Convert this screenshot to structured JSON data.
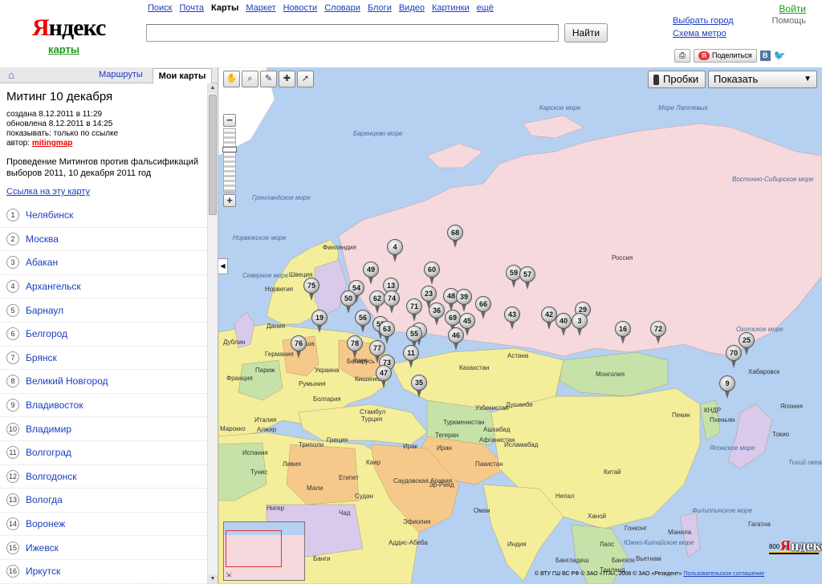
{
  "logo": {
    "first_letter": "Я",
    "rest": "ндекс",
    "service": "карты"
  },
  "topnav": [
    {
      "label": "Поиск",
      "current": false
    },
    {
      "label": "Почта",
      "current": false
    },
    {
      "label": "Карты",
      "current": true
    },
    {
      "label": "Маркет",
      "current": false
    },
    {
      "label": "Новости",
      "current": false
    },
    {
      "label": "Словари",
      "current": false
    },
    {
      "label": "Блоги",
      "current": false
    },
    {
      "label": "Видео",
      "current": false
    },
    {
      "label": "Картинки",
      "current": false
    },
    {
      "label": "ещё",
      "current": false
    }
  ],
  "search": {
    "value": "",
    "button_label": "Найти"
  },
  "user": {
    "login": "Войти",
    "help": "Помощь"
  },
  "links": {
    "choose_city": "Выбрать город",
    "metro": "Схема метро"
  },
  "share": {
    "print_icon": "printer-icon",
    "share_label": "Поделиться",
    "vk": "B",
    "twitter_icon": "twitter-icon"
  },
  "sidebar": {
    "tab_routes": "Маршруты",
    "tab_mymaps": "Мои карты",
    "title": "Митинг 10 декабря",
    "created": "создана 8.12.2011 в 11:29",
    "updated": "обновлена 8.12.2011 в 14:25",
    "visibility": "показывать: только по ссылке",
    "author_prefix": "автор: ",
    "author": "mitingmap",
    "description": "Проведение Митингов против фальсификаций выборов 2011, 10 декабря 2011 год",
    "link_label": "Ссылка на эту карту",
    "points": [
      {
        "n": "1",
        "label": "Челябинск"
      },
      {
        "n": "2",
        "label": "Москва"
      },
      {
        "n": "3",
        "label": "Абакан"
      },
      {
        "n": "4",
        "label": "Архангельск"
      },
      {
        "n": "5",
        "label": "Барнаул"
      },
      {
        "n": "6",
        "label": "Белгород"
      },
      {
        "n": "7",
        "label": "Брянск"
      },
      {
        "n": "8",
        "label": "Великий Новгород"
      },
      {
        "n": "9",
        "label": "Владивосток"
      },
      {
        "n": "10",
        "label": "Владимир"
      },
      {
        "n": "11",
        "label": "Волгоград"
      },
      {
        "n": "12",
        "label": "Волгодонск"
      },
      {
        "n": "13",
        "label": "Вологда"
      },
      {
        "n": "14",
        "label": "Воронеж"
      },
      {
        "n": "15",
        "label": "Ижевск"
      },
      {
        "n": "16",
        "label": "Иркутск"
      }
    ]
  },
  "map": {
    "traffic_label": "Пробки",
    "show_label": "Показать",
    "scale_label": "800 км",
    "copyright": "© ВТУ ГШ ВС РФ © ЗАО «ТГА», 2008 © ЗАО «Резидент»",
    "terms": "Пользовательское соглашение",
    "colors": {
      "sea": "#b5d0f0",
      "russia": "#f5d9dc",
      "europe_yellow": "#f4ee9a",
      "green": "#c6e2a8",
      "orange": "#f6c98a",
      "purple": "#d9c9ea"
    },
    "labels": [
      {
        "t": "Карское море",
        "sea": true
      },
      {
        "t": "Море Лаптевых",
        "sea": true
      },
      {
        "t": "Баренцево море",
        "sea": true
      },
      {
        "t": "Гренландское море",
        "sea": true
      },
      {
        "t": "Норвежское море",
        "sea": true
      },
      {
        "t": "Восточно-Сибирское море",
        "sea": true
      },
      {
        "t": "Охотское море",
        "sea": true
      },
      {
        "t": "Северное море",
        "sea": true
      },
      {
        "t": "Россия",
        "sea": false
      },
      {
        "t": "Финляндия",
        "sea": false
      },
      {
        "t": "Швеция",
        "sea": false
      },
      {
        "t": "Норвегия",
        "sea": false
      },
      {
        "t": "Дания",
        "sea": false
      },
      {
        "t": "Дублин",
        "sea": false
      },
      {
        "t": "Германия",
        "sea": false
      },
      {
        "t": "Париж",
        "sea": false
      },
      {
        "t": "Франция",
        "sea": false
      },
      {
        "t": "Украина",
        "sea": false
      },
      {
        "t": "Киев",
        "sea": false
      },
      {
        "t": "Кишинев",
        "sea": false
      },
      {
        "t": "Румыния",
        "sea": false
      },
      {
        "t": "Болгария",
        "sea": false
      },
      {
        "t": "Стамбул",
        "sea": false
      },
      {
        "t": "Турция",
        "sea": false
      },
      {
        "t": "Казахстан",
        "sea": false
      },
      {
        "t": "Астана",
        "sea": false
      },
      {
        "t": "Монголия",
        "sea": false
      },
      {
        "t": "Хабаровск",
        "sea": false
      },
      {
        "t": "Пекин",
        "sea": false
      },
      {
        "t": "КНДР",
        "sea": false
      },
      {
        "t": "Пхеньян",
        "sea": false
      },
      {
        "t": "Японское море",
        "sea": true
      },
      {
        "t": "Токио",
        "sea": false
      },
      {
        "t": "Тегеран",
        "sea": false
      },
      {
        "t": "Ашхабад",
        "sea": false
      },
      {
        "t": "Туркменистан",
        "sea": false
      },
      {
        "t": "Узбекистан",
        "sea": false
      },
      {
        "t": "Душанбе",
        "sea": false
      },
      {
        "t": "Афганистан",
        "sea": false
      },
      {
        "t": "Исламабад",
        "sea": false
      },
      {
        "t": "Алжир",
        "sea": false
      },
      {
        "t": "Триполи",
        "sea": false
      },
      {
        "t": "Каир",
        "sea": false
      },
      {
        "t": "Египет",
        "sea": false
      },
      {
        "t": "Саудовская Аравия",
        "sea": false
      },
      {
        "t": "Эр-Рияд",
        "sea": false
      },
      {
        "t": "Нигер",
        "sea": false
      },
      {
        "t": "Чад",
        "sea": false
      },
      {
        "t": "Судан",
        "sea": false
      },
      {
        "t": "Эфиопия",
        "sea": false
      },
      {
        "t": "Аддис-Абеба",
        "sea": false
      },
      {
        "t": "Индия",
        "sea": false
      },
      {
        "t": "Бангладеш",
        "sea": false
      },
      {
        "t": "Тихий океан",
        "sea": true
      },
      {
        "t": "Филиппинское море",
        "sea": true
      },
      {
        "t": "Южно-Китайское море",
        "sea": true
      },
      {
        "t": "Бангкок",
        "sea": false
      },
      {
        "t": "Манила",
        "sea": false
      },
      {
        "t": "Гонконг",
        "sea": false
      },
      {
        "t": "Ханой",
        "sea": false
      },
      {
        "t": "Лаос",
        "sea": false
      },
      {
        "t": "Вьетнам",
        "sea": false
      },
      {
        "t": "Таиланд",
        "sea": false
      },
      {
        "t": "Гагатна",
        "sea": false
      },
      {
        "t": "Банги",
        "sea": false
      },
      {
        "t": "Ливия",
        "sea": false
      },
      {
        "t": "Оман",
        "sea": false
      },
      {
        "t": "Тунис",
        "sea": false
      },
      {
        "t": "Мали",
        "sea": false
      },
      {
        "t": "Марокко",
        "sea": false
      },
      {
        "t": "Испания",
        "sea": false
      },
      {
        "t": "Италия",
        "sea": false
      },
      {
        "t": "Греция",
        "sea": false
      },
      {
        "t": "Ирак",
        "sea": false
      },
      {
        "t": "Иран",
        "sea": false
      },
      {
        "t": "Пакистан",
        "sea": false
      },
      {
        "t": "Непал",
        "sea": false
      },
      {
        "t": "Китай",
        "sea": false
      },
      {
        "t": "Япония",
        "sea": false
      },
      {
        "t": "Польша",
        "sea": false
      },
      {
        "t": "Беларусь",
        "sea": false
      }
    ],
    "pins": [
      "4",
      "68",
      "49",
      "60",
      "59",
      "57",
      "54",
      "13",
      "75",
      "50",
      "62",
      "74",
      "23",
      "48",
      "39",
      "66",
      "43",
      "42",
      "29",
      "56",
      "71",
      "36",
      "69",
      "40",
      "3",
      "19",
      "58",
      "45",
      "63",
      "7",
      "16",
      "72",
      "76",
      "78",
      "55",
      "46",
      "25",
      "77",
      "11",
      "73",
      "70",
      "47",
      "35",
      "9"
    ]
  }
}
